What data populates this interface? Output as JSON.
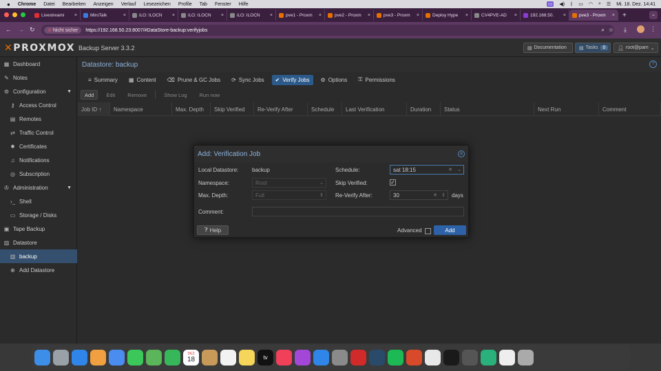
{
  "menubar": {
    "app": "Chrome",
    "items": [
      "Datei",
      "Bearbeiten",
      "Anzeigen",
      "Verlauf",
      "Lesezeichen",
      "Profile",
      "Tab",
      "Fenster",
      "Hilfe"
    ],
    "clock": "Mi. 18. Dez.  14:41"
  },
  "browser": {
    "tabs": [
      {
        "label": "Livestreami",
        "color": "#e03030"
      },
      {
        "label": "MiroTalk",
        "color": "#3a7be0"
      },
      {
        "label": "iLO: ILOCN",
        "color": "#888888"
      },
      {
        "label": "iLO: ILOCN",
        "color": "#888888"
      },
      {
        "label": "iLO: ILOCN",
        "color": "#888888"
      },
      {
        "label": "pve1 - Proxm",
        "color": "#e57000"
      },
      {
        "label": "pve2 - Proxm",
        "color": "#e57000"
      },
      {
        "label": "pve3 - Proxm",
        "color": "#e57000"
      },
      {
        "label": "Deploy Hype",
        "color": "#e57000"
      },
      {
        "label": "CV4PVE-AD",
        "color": "#888888"
      },
      {
        "label": "192.168.50.",
        "color": "#8a3bd0"
      },
      {
        "label": "pve3 - Proxm",
        "color": "#e57000"
      }
    ],
    "insecure": "Nicht sicher",
    "url": "https://192.168.50.23:8007/#DataStore-backup:verifyjobs"
  },
  "header": {
    "logo": "PROXMOX",
    "version": "Backup Server 3.3.2",
    "documentation": "Documentation",
    "tasks": "Tasks",
    "tasks_count": "0",
    "user": "root@pam"
  },
  "sidebar": {
    "items": [
      {
        "label": "Dashboard",
        "icon": "dashboard-icon",
        "glyph": "▦",
        "indent": 0
      },
      {
        "label": "Notes",
        "icon": "notes-icon",
        "glyph": "✎",
        "indent": 0
      },
      {
        "label": "Configuration",
        "icon": "gears-icon",
        "glyph": "⚙",
        "indent": 0,
        "caret": true
      },
      {
        "label": "Access Control",
        "icon": "key-icon",
        "glyph": "⚷",
        "indent": 1
      },
      {
        "label": "Remotes",
        "icon": "server-icon",
        "glyph": "▤",
        "indent": 1
      },
      {
        "label": "Traffic Control",
        "icon": "traffic-icon",
        "glyph": "⇄",
        "indent": 1
      },
      {
        "label": "Certificates",
        "icon": "certificate-icon",
        "glyph": "✹",
        "indent": 1
      },
      {
        "label": "Notifications",
        "icon": "bell-icon",
        "glyph": "♫",
        "indent": 1
      },
      {
        "label": "Subscription",
        "icon": "support-icon",
        "glyph": "◎",
        "indent": 1
      },
      {
        "label": "Administration",
        "icon": "wrench-icon",
        "glyph": "✇",
        "indent": 0,
        "caret": true
      },
      {
        "label": "Shell",
        "icon": "terminal-icon",
        "glyph": "›_",
        "indent": 1
      },
      {
        "label": "Storage / Disks",
        "icon": "hdd-icon",
        "glyph": "▭",
        "indent": 1
      },
      {
        "label": "Tape Backup",
        "icon": "tape-icon",
        "glyph": "▣",
        "indent": 0
      },
      {
        "label": "Datastore",
        "icon": "database-icon",
        "glyph": "▥",
        "indent": 0
      },
      {
        "label": "backup",
        "icon": "database-icon",
        "glyph": "▥",
        "indent": 1,
        "selected": true
      },
      {
        "label": "Add Datastore",
        "icon": "plus-circle-icon",
        "glyph": "⊕",
        "indent": 1
      }
    ]
  },
  "main": {
    "breadcrumb": "Datastore: backup",
    "tabs": [
      {
        "label": "Summary",
        "glyph": "≡"
      },
      {
        "label": "Content",
        "glyph": "▦"
      },
      {
        "label": "Prune & GC Jobs",
        "glyph": "⌫"
      },
      {
        "label": "Sync Jobs",
        "glyph": "⟳"
      },
      {
        "label": "Verify Jobs",
        "glyph": "✔",
        "active": true
      },
      {
        "label": "Options",
        "glyph": "⚙"
      },
      {
        "label": "Permissions",
        "glyph": "⚿"
      }
    ],
    "toolbar": {
      "add": "Add",
      "edit": "Edit",
      "remove": "Remove",
      "show_log": "Show Log",
      "run_now": "Run now"
    },
    "columns": [
      "Job ID ↑",
      "Namespace",
      "Max. Depth",
      "Skip Verified",
      "Re-Verify After",
      "Schedule",
      "Last Verification",
      "Duration",
      "Status",
      "Next Run",
      "Comment"
    ]
  },
  "dialog": {
    "title": "Add: Verification Job",
    "local_datastore_label": "Local Datastore:",
    "local_datastore_value": "backup",
    "namespace_label": "Namespace:",
    "namespace_value": "Root",
    "max_depth_label": "Max. Depth:",
    "max_depth_value": "Full",
    "comment_label": "Comment:",
    "comment_value": "",
    "schedule_label": "Schedule:",
    "schedule_value": "sat 18:15",
    "skip_verified_label": "Skip Verified:",
    "skip_verified_checked": true,
    "reverify_label": "Re-Verify After:",
    "reverify_value": "30",
    "reverify_unit": "days",
    "help": "Help",
    "advanced": "Advanced",
    "add": "Add"
  },
  "dock": {
    "calendar_month": "DEZ",
    "calendar_day": "18",
    "tv_label": "tv",
    "apps": [
      {
        "name": "finder-icon",
        "color": "#3d8ee8"
      },
      {
        "name": "launchpad-icon",
        "color": "#9aa0a8"
      },
      {
        "name": "safari-icon",
        "color": "#2f86e8"
      },
      {
        "name": "photos-icon",
        "color": "#f0a040"
      },
      {
        "name": "mail-icon",
        "color": "#4a8cf0"
      },
      {
        "name": "messages-icon",
        "color": "#3cc75a"
      },
      {
        "name": "maps-icon",
        "color": "#5bb55a"
      },
      {
        "name": "facetime-icon",
        "color": "#36b85a"
      },
      {
        "name": "calendar-icon",
        "color": "#ffffff"
      },
      {
        "name": "contacts-icon",
        "color": "#c89a5a"
      },
      {
        "name": "reminders-icon",
        "color": "#f2f2f2"
      },
      {
        "name": "notes-app-icon",
        "color": "#f5d65a"
      },
      {
        "name": "appletv-icon",
        "color": "#111111"
      },
      {
        "name": "music-icon",
        "color": "#f0405a"
      },
      {
        "name": "podcasts-icon",
        "color": "#a347d8"
      },
      {
        "name": "appstore-icon",
        "color": "#2f86e8"
      },
      {
        "name": "settings-icon",
        "color": "#8a8a8a"
      },
      {
        "name": "teamviewer-icon",
        "color": "#d02a2a"
      },
      {
        "name": "quicktime-icon",
        "color": "#2a4a6a"
      },
      {
        "name": "spotify-icon",
        "color": "#1db954"
      },
      {
        "name": "virus-app-icon",
        "color": "#d84a2a"
      },
      {
        "name": "chrome-icon",
        "color": "#e8e8e8"
      },
      {
        "name": "terminal-icon",
        "color": "#1a1a1a"
      },
      {
        "name": "calculator-icon",
        "color": "#555555"
      },
      {
        "name": "sync-app-icon",
        "color": "#2ab07a"
      },
      {
        "name": "document-icon",
        "color": "#eeeeee"
      },
      {
        "name": "trash-icon",
        "color": "#aaaaaa"
      }
    ]
  }
}
